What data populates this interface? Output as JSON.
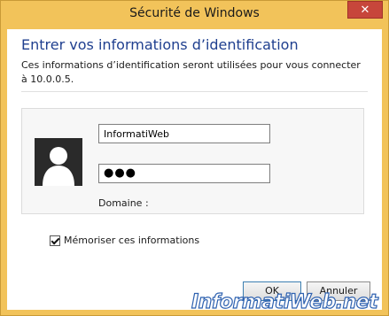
{
  "window": {
    "title": "Sécurité de Windows",
    "close_label": "✕"
  },
  "dialog": {
    "heading": "Entrer vos informations d’identification",
    "description": "Ces informations d’identification seront utilisées pour vous connecter à 10.0.0.5."
  },
  "credentials": {
    "username_value": "InformatiWeb",
    "password_value": "●●●",
    "domain_label": "Domaine :"
  },
  "remember": {
    "label": "Mémoriser ces informations",
    "checked": true
  },
  "buttons": {
    "ok_label": "OK",
    "cancel_label": "Annuler"
  },
  "watermark": {
    "text": "InformatiWeb.net"
  },
  "colors": {
    "frame": "#f2c35a",
    "heading": "#1f3f8f",
    "close": "#c7463b"
  }
}
